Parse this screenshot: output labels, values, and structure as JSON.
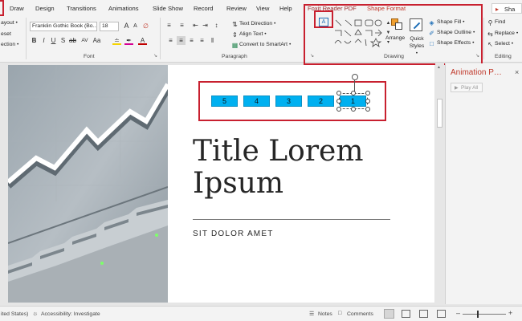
{
  "tabs": [
    "Draw",
    "Design",
    "Transitions",
    "Animations",
    "Slide Show",
    "Record",
    "Review",
    "View",
    "Help",
    "Foxit Reader PDF",
    "Shape Format",
    "Sha"
  ],
  "ribbon": {
    "slides_group": {
      "layout": "ayout •",
      "reset": "eset",
      "section": "ection •"
    },
    "font": {
      "name": "Franklin Gothic Book (Bo…",
      "size": "18",
      "label": "Font"
    },
    "paragraph": {
      "text_direction": "Text Direction •",
      "align_text": "Align Text •",
      "convert_smartart": "Convert to SmartArt •",
      "label": "Paragraph"
    },
    "drawing": {
      "arrange": "Arrange",
      "quick_styles": "Quick Styles •",
      "shape_fill": "Shape Fill •",
      "shape_outline": "Shape Outline •",
      "shape_effects": "Shape Effects •",
      "label": "Drawing"
    },
    "editing": {
      "find": "Find",
      "replace": "Replace •",
      "select": "Select •",
      "label": "Editing"
    }
  },
  "slide": {
    "boxes": [
      "5",
      "4",
      "3",
      "2",
      "1"
    ],
    "title_line1": "Title Lorem",
    "title_line2": "Ipsum",
    "subtitle": "SIT DOLOR AMET"
  },
  "animation_pane": {
    "title": "Animation P…",
    "play_all": "Play All"
  },
  "status": {
    "language": "ited States)",
    "accessibility": "Accessibility: Investigate",
    "notes": "Notes",
    "comments": "Comments"
  },
  "colors": {
    "accent_red": "#c8202f",
    "box_fill": "#00b0f0",
    "context_tab": "#c0392b"
  }
}
